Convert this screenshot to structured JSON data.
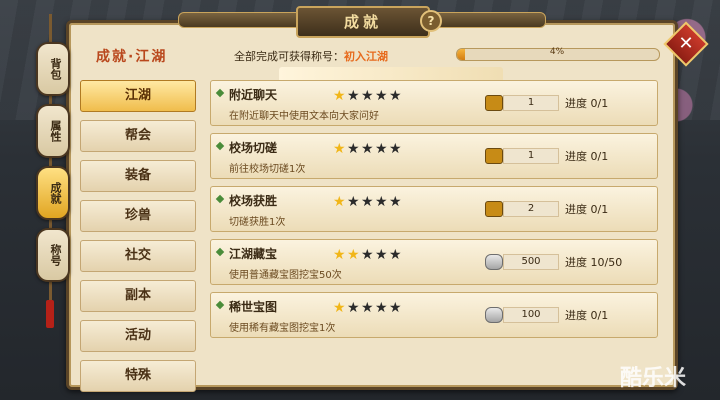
{
  "header": {
    "title": "成就"
  },
  "side_tabs": [
    {
      "label": "背包",
      "active": false
    },
    {
      "label": "属性",
      "active": false
    },
    {
      "label": "成就",
      "active": true
    },
    {
      "label": "称号",
      "active": false
    }
  ],
  "left_panel": {
    "title": "成就·江湖",
    "items": [
      {
        "label": "江湖",
        "active": true
      },
      {
        "label": "帮会",
        "active": false
      },
      {
        "label": "装备",
        "active": false
      },
      {
        "label": "珍兽",
        "active": false
      },
      {
        "label": "社交",
        "active": false
      },
      {
        "label": "副本",
        "active": false
      },
      {
        "label": "活动",
        "active": false
      },
      {
        "label": "特殊",
        "active": false
      }
    ]
  },
  "completion": {
    "label": "全部完成可获得称号：",
    "reward_title": "初入江湖",
    "progress_text": "4%",
    "progress_fraction": 0.04
  },
  "achievements": [
    {
      "name": "附近聊天",
      "desc": "在附近聊天中使用文本向大家问好",
      "stars": 1,
      "reward_icon": "gold-ingot-icon",
      "reward_value": "1",
      "progress": "进度 0/1"
    },
    {
      "name": "校场切磋",
      "desc": "前往校场切磋1次",
      "stars": 1,
      "reward_icon": "gold-ingot-icon",
      "reward_value": "1",
      "progress": "进度 0/1"
    },
    {
      "name": "校场获胜",
      "desc": "切磋获胜1次",
      "stars": 1,
      "reward_icon": "gold-ingot-icon",
      "reward_value": "2",
      "progress": "进度 0/1"
    },
    {
      "name": "江湖藏宝",
      "desc": "使用普通藏宝图挖宝50次",
      "stars": 2,
      "reward_icon": "silver-ingot-icon",
      "reward_value": "500",
      "progress": "进度 10/50"
    },
    {
      "name": "稀世宝图",
      "desc": "使用稀有藏宝图挖宝1次",
      "stars": 1,
      "reward_icon": "silver-ingot-icon",
      "reward_value": "100",
      "progress": "进度 0/1"
    }
  ],
  "star_total": 5,
  "watermark": "酷乐米"
}
